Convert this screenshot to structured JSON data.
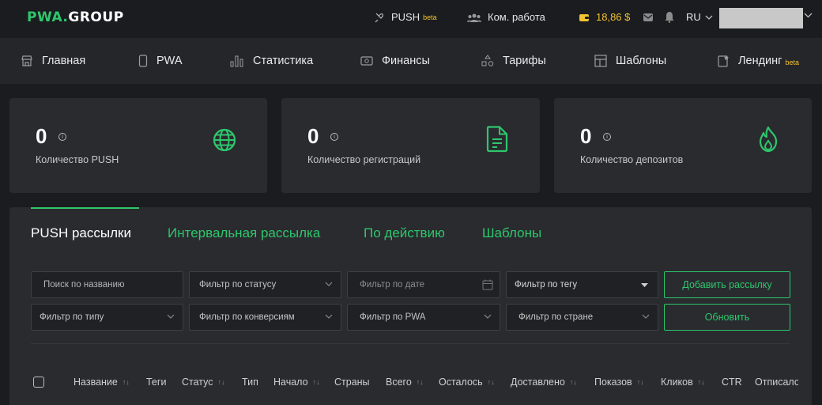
{
  "header": {
    "logo_left": "PWA",
    "logo_dot": ".",
    "logo_right": "GROUP",
    "push_label": "PUSH",
    "push_badge": "beta",
    "team_label": "Ком. работа",
    "balance": "18,86 $",
    "language": "RU"
  },
  "nav": {
    "items": [
      {
        "label": "Главная",
        "icon": "store-icon"
      },
      {
        "label": "PWA",
        "icon": "phone-icon"
      },
      {
        "label": "Статистика",
        "icon": "bar-chart-icon"
      },
      {
        "label": "Финансы",
        "icon": "money-icon"
      },
      {
        "label": "Тарифы",
        "icon": "tariff-icon"
      },
      {
        "label": "Шаблоны",
        "icon": "layout-icon"
      },
      {
        "label": "Лендинг",
        "icon": "landing-icon",
        "badge": "beta"
      }
    ]
  },
  "stats": [
    {
      "value": "0",
      "label": "Количество PUSH",
      "icon": "globe-icon"
    },
    {
      "value": "0",
      "label": "Количество регистраций",
      "icon": "document-icon"
    },
    {
      "value": "0",
      "label": "Количество депозитов",
      "icon": "fire-icon"
    }
  ],
  "tabs": [
    "PUSH рассылки",
    "Интервальная рассылка",
    "По действию",
    "Шаблоны"
  ],
  "filters": {
    "search_placeholder": "Поиск по названию",
    "status": "Фильтр по статусу",
    "date_placeholder": "Фильтр по дате",
    "tag": "Фильтр по тегу",
    "type": "Фильтр по типу",
    "conversions": "Фильтр по конверсиям",
    "pwa": "Фильтр по PWA",
    "country": "Фильтр по стране"
  },
  "buttons": {
    "add": "Добавить рассылку",
    "refresh": "Обновить"
  },
  "table": {
    "columns": [
      "Название",
      "Теги",
      "Статус",
      "Тип",
      "Начало",
      "Страны",
      "Всего",
      "Осталось",
      "Доставлено",
      "Показов",
      "Кликов",
      "CTR",
      "Отписало"
    ]
  },
  "colors": {
    "accent": "#2ec76c",
    "beta": "#f2c230",
    "background": "#1a1c1f",
    "card": "#292b2f"
  }
}
